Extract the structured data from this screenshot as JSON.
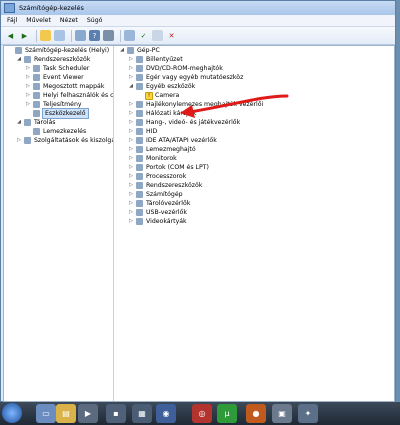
{
  "window": {
    "title": "Számítógép-kezelés"
  },
  "menu": [
    "Fájl",
    "Művelet",
    "Nézet",
    "Súgó"
  ],
  "left_tree": [
    {
      "label": "Számítógép-kezelés (Helyi)",
      "indent": 0,
      "expander": "",
      "icon": "computer-management-icon"
    },
    {
      "label": "Rendszereszközök",
      "indent": 1,
      "expander": "◢",
      "icon": "tools-icon"
    },
    {
      "label": "Task Scheduler",
      "indent": 2,
      "expander": "▷",
      "icon": "clock-icon"
    },
    {
      "label": "Event Viewer",
      "indent": 2,
      "expander": "▷",
      "icon": "event-viewer-icon"
    },
    {
      "label": "Megosztott mappák",
      "indent": 2,
      "expander": "▷",
      "icon": "shared-folder-icon"
    },
    {
      "label": "Helyi felhasználók és cs",
      "indent": 2,
      "expander": "▷",
      "icon": "users-icon"
    },
    {
      "label": "Teljesítmény",
      "indent": 2,
      "expander": "▷",
      "icon": "performance-icon"
    },
    {
      "label": "Eszközkezelő",
      "indent": 2,
      "expander": "",
      "icon": "device-manager-icon",
      "selected": true
    },
    {
      "label": "Tárolás",
      "indent": 1,
      "expander": "◢",
      "icon": "storage-icon"
    },
    {
      "label": "Lemezkezelés",
      "indent": 2,
      "expander": "",
      "icon": "disk-icon"
    },
    {
      "label": "Szolgáltatások és kiszolgálá",
      "indent": 1,
      "expander": "▷",
      "icon": "services-icon"
    }
  ],
  "right_tree": [
    {
      "label": "Gép-PC",
      "indent": 0,
      "expander": "◢",
      "icon": "computer-icon"
    },
    {
      "label": "Billentyűzet",
      "indent": 1,
      "expander": "▷",
      "icon": "keyboard-icon"
    },
    {
      "label": "DVD/CD-ROM-meghajtók",
      "indent": 1,
      "expander": "▷",
      "icon": "dvd-icon"
    },
    {
      "label": "Egér vagy egyéb mutatóeszköz",
      "indent": 1,
      "expander": "▷",
      "icon": "mouse-icon"
    },
    {
      "label": "Egyéb eszközök",
      "indent": 1,
      "expander": "◢",
      "icon": "other-devices-icon"
    },
    {
      "label": "Camera",
      "indent": 2,
      "expander": "",
      "icon": "warning-icon",
      "warn": true
    },
    {
      "label": "Hajlékonylemezes meghajtók vezérlői",
      "indent": 1,
      "expander": "▷",
      "icon": "floppy-controller-icon"
    },
    {
      "label": "Hálózati kártyák",
      "indent": 1,
      "expander": "▷",
      "icon": "network-icon"
    },
    {
      "label": "Hang-, videó- és játékvezérlők",
      "indent": 1,
      "expander": "▷",
      "icon": "sound-icon"
    },
    {
      "label": "HID",
      "indent": 1,
      "expander": "▷",
      "icon": "hid-icon"
    },
    {
      "label": "IDE ATA/ATAPI vezérlők",
      "indent": 1,
      "expander": "▷",
      "icon": "ide-icon"
    },
    {
      "label": "Lemezmeghajtó",
      "indent": 1,
      "expander": "▷",
      "icon": "disk-drive-icon"
    },
    {
      "label": "Monitorok",
      "indent": 1,
      "expander": "▷",
      "icon": "monitor-icon"
    },
    {
      "label": "Portok (COM és LPT)",
      "indent": 1,
      "expander": "▷",
      "icon": "port-icon"
    },
    {
      "label": "Processzorok",
      "indent": 1,
      "expander": "▷",
      "icon": "processor-icon"
    },
    {
      "label": "Rendszereszközök",
      "indent": 1,
      "expander": "▷",
      "icon": "system-devices-icon"
    },
    {
      "label": "Számítógép",
      "indent": 1,
      "expander": "▷",
      "icon": "computer-small-icon"
    },
    {
      "label": "Tárolóvezérlők",
      "indent": 1,
      "expander": "▷",
      "icon": "storage-controller-icon"
    },
    {
      "label": "USB-vezérlők",
      "indent": 1,
      "expander": "▷",
      "icon": "usb-icon"
    },
    {
      "label": "Videokártyák",
      "indent": 1,
      "expander": "▷",
      "icon": "video-card-icon"
    }
  ],
  "colors": {
    "arrow": "#e01919",
    "accent": "#1a4f9a"
  }
}
